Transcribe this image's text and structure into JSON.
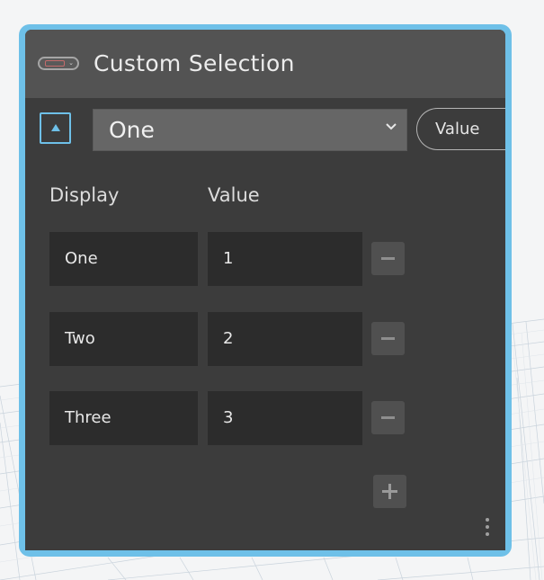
{
  "node": {
    "title": "Custom Selection",
    "icon": "number-selector-icon",
    "accent_color": "#6ec0e8"
  },
  "toolbar": {
    "collapse_icon": "triangle-up-icon",
    "dropdown_selected": "One",
    "dropdown_icon": "chevron-down-icon"
  },
  "output_port": {
    "label": "Value"
  },
  "table": {
    "headers": {
      "display": "Display",
      "value": "Value"
    },
    "rows": [
      {
        "display": "One",
        "value": "1"
      },
      {
        "display": "Two",
        "value": "2"
      },
      {
        "display": "Three",
        "value": "3"
      }
    ]
  },
  "actions": {
    "remove_icon": "minus-icon",
    "add_icon": "plus-icon",
    "menu_icon": "vertical-ellipsis-icon"
  }
}
